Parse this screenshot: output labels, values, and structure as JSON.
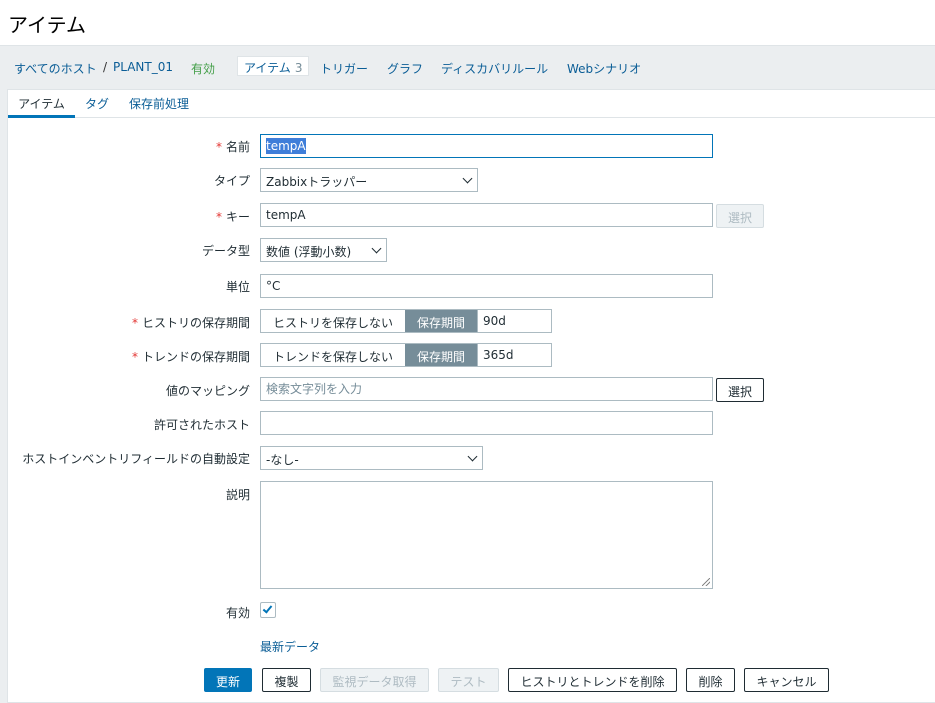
{
  "page": {
    "title": "アイテム"
  },
  "breadcrumb": {
    "all_hosts": "すべてのホスト",
    "separator": "/",
    "host": "PLANT_01",
    "status": "有効",
    "items_label": "アイテム",
    "items_count": "3",
    "triggers": "トリガー",
    "graphs": "グラフ",
    "discovery": "ディスカバリルール",
    "web": "Webシナリオ"
  },
  "tabs": {
    "item": "アイテム",
    "tags": "タグ",
    "preprocessing": "保存前処理"
  },
  "form": {
    "required_mark": "*",
    "name": {
      "label": "名前",
      "value": "tempA"
    },
    "type": {
      "label": "タイプ",
      "value": "Zabbixトラッパー"
    },
    "key": {
      "label": "キー",
      "value": "tempA",
      "select_button": "選択"
    },
    "data_type": {
      "label": "データ型",
      "value": "数値 (浮動小数)"
    },
    "units": {
      "label": "単位",
      "value": "°C"
    },
    "history": {
      "label": "ヒストリの保存期間",
      "option_off": "ヒストリを保存しない",
      "option_on": "保存期間",
      "value": "90d"
    },
    "trends": {
      "label": "トレンドの保存期間",
      "option_off": "トレンドを保存しない",
      "option_on": "保存期間",
      "value": "365d"
    },
    "value_mapping": {
      "label": "値のマッピング",
      "placeholder": "検索文字列を入力",
      "select_button": "選択"
    },
    "allowed_hosts": {
      "label": "許可されたホスト",
      "value": ""
    },
    "inventory": {
      "label": "ホストインベントリフィールドの自動設定",
      "value": "-なし-"
    },
    "description": {
      "label": "説明",
      "value": ""
    },
    "enabled": {
      "label": "有効",
      "checked": true
    },
    "latest_data_link": "最新データ"
  },
  "buttons": {
    "update": "更新",
    "clone": "複製",
    "execute_now": "監視データ取得",
    "test": "テスト",
    "clear_history": "ヒストリとトレンドを削除",
    "delete": "削除",
    "cancel": "キャンセル"
  }
}
